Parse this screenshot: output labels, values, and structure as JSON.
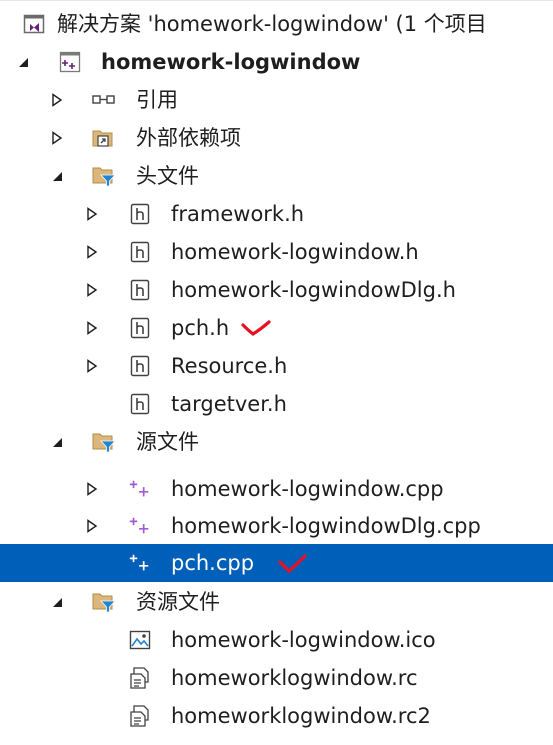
{
  "solution": {
    "label": "解决方案 'homework-logwindow' (1 个项目"
  },
  "project": {
    "label": "homework-logwindow"
  },
  "references": {
    "label": "引用"
  },
  "external_deps": {
    "label": "外部依赖项"
  },
  "header_files": {
    "label": "头文件",
    "items": [
      "framework.h",
      "homework-logwindow.h",
      "homework-logwindowDlg.h",
      "pch.h",
      "Resource.h",
      "targetver.h"
    ]
  },
  "source_files": {
    "label": "源文件",
    "items": [
      "homework-logwindow.cpp",
      "homework-logwindowDlg.cpp",
      "pch.cpp"
    ],
    "selected": "pch.cpp"
  },
  "resource_files": {
    "label": "资源文件",
    "items": [
      "homework-logwindow.ico",
      "homeworklogwindow.rc",
      "homeworklogwindow.rc2"
    ]
  },
  "colors": {
    "selection": "#005fb8",
    "folder": "#dcb67a",
    "folder_filter": "#1e86d2",
    "cpp_icon": "#a05bd6",
    "check_mark": "#e81123",
    "project_icon": "#68217a"
  },
  "icons": {
    "solution": "solution-icon",
    "project": "vc-project-icon",
    "references": "references-icon",
    "external_deps": "external-dependencies-icon",
    "filter_folder": "filter-folder-icon",
    "header": "header-file-icon",
    "cpp": "cpp-file-icon",
    "ico": "image-file-icon",
    "rc": "resource-file-icon",
    "annotation": "red-check-mark"
  }
}
